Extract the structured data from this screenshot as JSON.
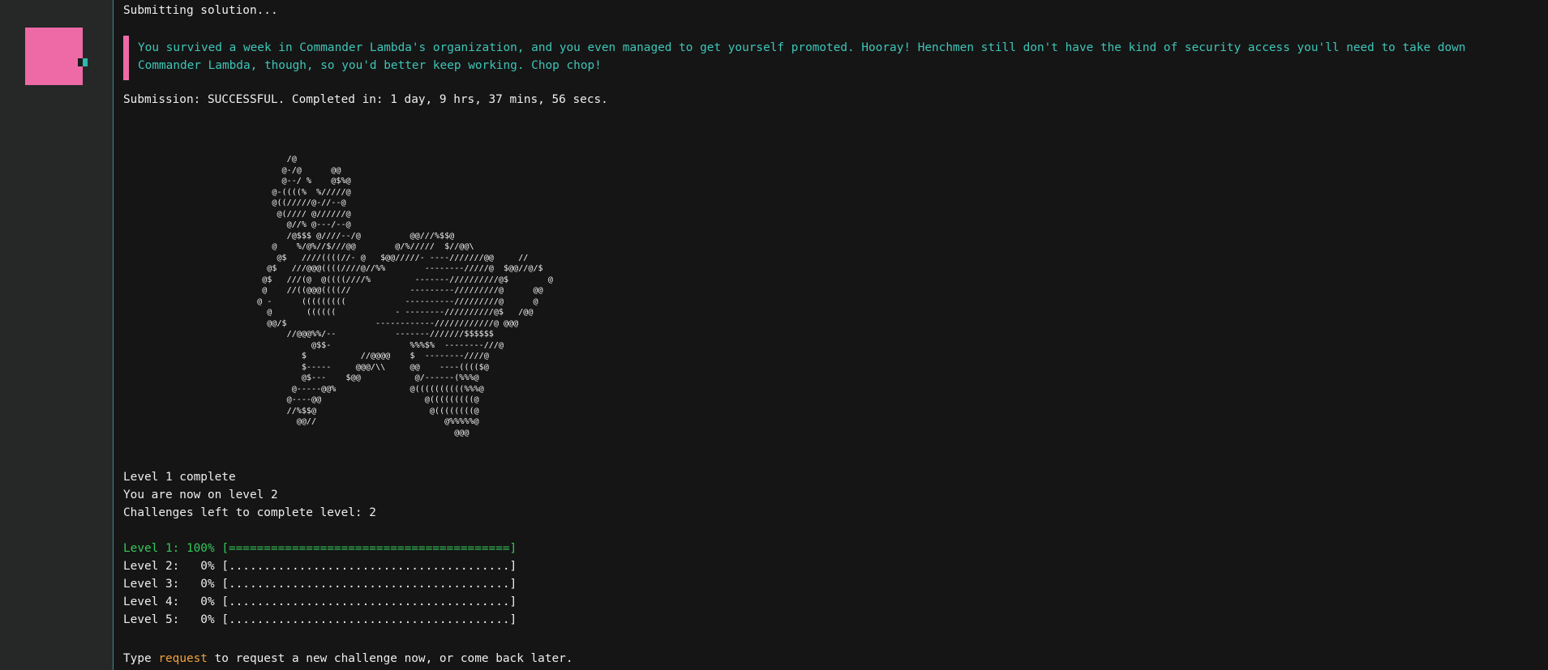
{
  "terminal": {
    "submitting": "Submitting solution...",
    "message": "You survived a week in Commander Lambda's organization, and you even managed to get yourself promoted. Hooray! Henchmen still don't have the kind of security access you'll need to take down\nCommander Lambda, though, so you'd better keep working. Chop chop!",
    "submission_status": "Submission: SUCCESSFUL. Completed in: 1 day, 9 hrs, 37 mins, 56 secs.",
    "ascii_art": "        /@\n       @-/@      @@\n       @--/ %    @$%@\n     @-((((%  %/////@\n     @((/////@-//--@\n      @(//// @//////@\n        @//% @---/--@\n        /@$$$ @////--/@          @@///%$$@\n     @    %/@%//$///@@        @/%/////  $//@@\\\n      @$   ////((((//- @   $@@/////- ----///////@@     //\n    @$   ///@@@((((////@//%%        --------/////@  $@@//@/$\n   @$   ///(@  @((((////%         -------//////////@$        @\n   @    //((@@@((((//            ---------/////////@      @@\n  @ -      (((((((((            ----------/////////@      @\n    @       ((((((            - --------//////////@$   /@@\n    @@/$                  ------------////////////@ @@@\n        //@@@%%/--            -------///////$$$$$$\n             @$$-                %%%$%  --------///@\n           $           //@@@@    $  --------////@\n           $-----     @@@/\\\\     @@    ----(((($@\n           @$---    $@@           @/------(%%%@\n         @-----@@%               @((((((((((%%%@\n        @----@@                     @(((((((((@\n        //%$$@                       @((((((((@\n          @@//                          @%%%%%@\n                                          @@@",
    "level_complete": "Level 1 complete",
    "now_on_level": "You are now on level 2",
    "challenges_left": "Challenges left to complete level: 2",
    "progress": [
      {
        "label": "Level 1:",
        "percent": "100%",
        "bar": "[========================================]"
      },
      {
        "label": "Level 2:",
        "percent": "  0%",
        "bar": "[........................................]"
      },
      {
        "label": "Level 3:",
        "percent": "  0%",
        "bar": "[........................................]"
      },
      {
        "label": "Level 4:",
        "percent": "  0%",
        "bar": "[........................................]"
      },
      {
        "label": "Level 5:",
        "percent": "  0%",
        "bar": "[........................................]"
      }
    ],
    "prompt_prefix": "Type ",
    "prompt_command": "request",
    "prompt_suffix": " to request a new challenge now, or come back later."
  },
  "colors": {
    "background": "#151515",
    "sidebar": "#262828",
    "accent_pink": "#ee6aa7",
    "accent_teal": "#3ec5b8",
    "success_green": "#35c85a",
    "command_orange": "#f0a23a"
  }
}
